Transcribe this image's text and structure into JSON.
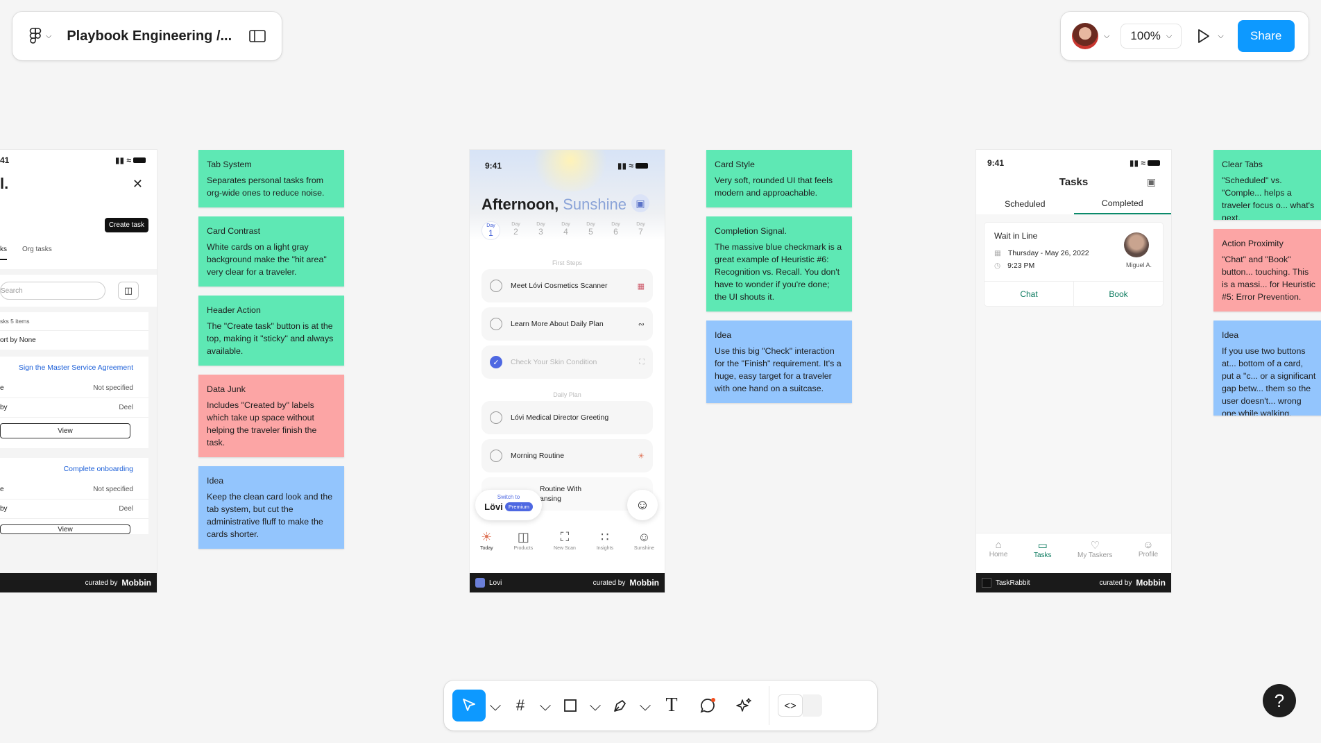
{
  "topbar": {
    "file_title": "Playbook Engineering /...",
    "zoom": "100%",
    "share_label": "Share"
  },
  "notes_col1": [
    {
      "title": "Tab System",
      "body": "Separates personal tasks from org-wide ones to reduce noise.",
      "color": "green"
    },
    {
      "title": "Card Contrast",
      "body": "White cards on a light gray background make the \"hit area\" very clear for a traveler.",
      "color": "green"
    },
    {
      "title": "Header Action",
      "body": "The \"Create task\" button is at the top, making it \"sticky\" and always available.",
      "color": "green"
    },
    {
      "title": "Data Junk",
      "body": "Includes \"Created by\" labels which take up space without helping the traveler finish the task.",
      "color": "red"
    },
    {
      "title": "Idea",
      "body": "Keep the clean card look and the tab system, but cut the administrative fluff to make the cards shorter.",
      "color": "blue"
    }
  ],
  "notes_col2": [
    {
      "title": "Card Style",
      "body": "Very soft, rounded UI that feels modern and approachable.",
      "color": "green"
    },
    {
      "title": "Completion Signal.",
      "body": "The massive blue checkmark is a great example of Heuristic #6: Recognition vs. Recall. You don't have to wonder if you're done; the UI shouts it.",
      "color": "green"
    },
    {
      "title": "Idea",
      "body": "Use this big \"Check\" interaction for the \"Finish\" requirement. It's a huge, easy target for a traveler with one hand on a suitcase.",
      "color": "blue"
    }
  ],
  "notes_col3": [
    {
      "title": "Clear Tabs",
      "body": "\"Scheduled\" vs. \"Comple... helps a traveler focus o... what's next.",
      "color": "green"
    },
    {
      "title": "Action Proximity",
      "body": "\"Chat\" and \"Book\" button... touching. This is a massi... for Heuristic #5: Error Prevention.",
      "color": "red"
    },
    {
      "title": "Idea",
      "body": "If you use two buttons at... bottom of a card, put a \"c... or a significant gap betw... them so the user doesn't... wrong one while walking.",
      "color": "blue"
    }
  ],
  "phone1": {
    "time": "41",
    "heading": "l.",
    "create_task": "Create task",
    "tabs": [
      "ks",
      "Org tasks"
    ],
    "search_placeholder": "Search",
    "count": "sks 5 items",
    "sort": "ort by None",
    "cards": [
      {
        "title": "Sign the Master Service Agreement",
        "r1l": "e",
        "r1v": "Not specified",
        "r2l": "by",
        "r2v": "Deel",
        "btn": "View"
      },
      {
        "title": "Complete onboarding",
        "r1l": "e",
        "r1v": "Not specified",
        "r2l": "by",
        "r2v": "Deel",
        "btn": "View"
      }
    ],
    "curated": "curated by",
    "brand": "Mobbin"
  },
  "phone2": {
    "time": "9:41",
    "greeting": "Afternoon,",
    "name": "Sunshine",
    "days": [
      {
        "l": "Day",
        "n": "1"
      },
      {
        "l": "Day",
        "n": "2"
      },
      {
        "l": "Day",
        "n": "3"
      },
      {
        "l": "Day",
        "n": "4"
      },
      {
        "l": "Day",
        "n": "5"
      },
      {
        "l": "Day",
        "n": "6"
      },
      {
        "l": "Day",
        "n": "7"
      }
    ],
    "section1": "First Steps",
    "tasks1": [
      "Meet Lóvi Cosmetics Scanner",
      "Learn More About Daily Plan",
      "Check Your Skin Condition"
    ],
    "section2": "Daily Plan",
    "tasks2": [
      "Lóvi Medical Director Greeting",
      "Morning Routine",
      "Routine With\nansing"
    ],
    "switch_to": "Switch to",
    "premium": "Premium",
    "brand_logo": "Lövi",
    "nav": [
      "Today",
      "Products",
      "New Scan",
      "Insights",
      "Sunshine"
    ],
    "app": "Lovi",
    "curated": "curated by",
    "brand": "Mobbin"
  },
  "phone3": {
    "time": "9:41",
    "title": "Tasks",
    "tabs": [
      "Scheduled",
      "Completed"
    ],
    "task_title": "Wait in Line",
    "date": "Thursday - May 26, 2022",
    "time_label": "9:23 PM",
    "tasker": "Miguel A.",
    "chat": "Chat",
    "book": "Book",
    "nav": [
      "Home",
      "Tasks",
      "My Taskers",
      "Profile"
    ],
    "app": "TaskRabbit",
    "curated": "curated by",
    "brand": "Mobbin"
  }
}
